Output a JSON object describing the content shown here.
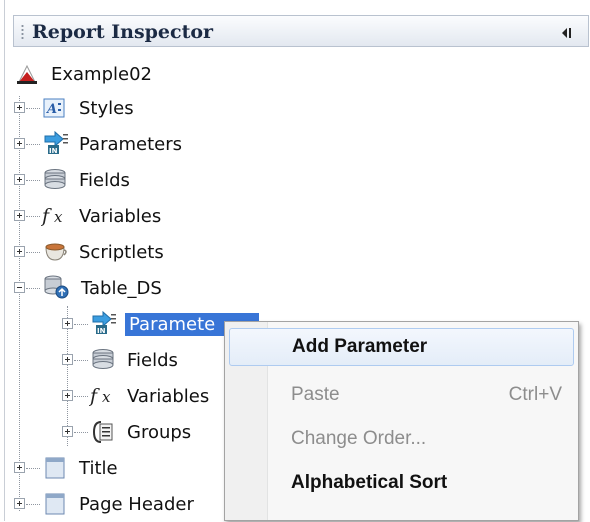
{
  "panel": {
    "title": "Report Inspector"
  },
  "tree": {
    "root": "Example02",
    "items": [
      {
        "label": "Styles",
        "icon": "styles-icon"
      },
      {
        "label": "Parameters",
        "icon": "parameters-icon"
      },
      {
        "label": "Fields",
        "icon": "fields-icon"
      },
      {
        "label": "Variables",
        "icon": "variables-icon"
      },
      {
        "label": "Scriptlets",
        "icon": "scriptlets-icon"
      },
      {
        "label": "Table_DS",
        "icon": "dataset-icon"
      }
    ],
    "children": [
      {
        "label": "Paramete",
        "icon": "parameters-icon"
      },
      {
        "label": "Fields",
        "icon": "fields-icon"
      },
      {
        "label": "Variables",
        "icon": "variables-icon"
      },
      {
        "label": "Groups",
        "icon": "groups-icon"
      }
    ],
    "bands": [
      {
        "label": "Title",
        "icon": "band-icon"
      },
      {
        "label": "Page Header",
        "icon": "band-icon"
      }
    ]
  },
  "context_menu": {
    "items": [
      {
        "label": "Add Parameter",
        "shortcut": ""
      },
      {
        "label": "Paste",
        "shortcut": "Ctrl+V"
      },
      {
        "label": "Change Order...",
        "shortcut": ""
      },
      {
        "label": "Alphabetical Sort",
        "shortcut": ""
      }
    ]
  },
  "colors": {
    "selection": "#3875d7",
    "menu_hover_border": "#aecbf0"
  }
}
